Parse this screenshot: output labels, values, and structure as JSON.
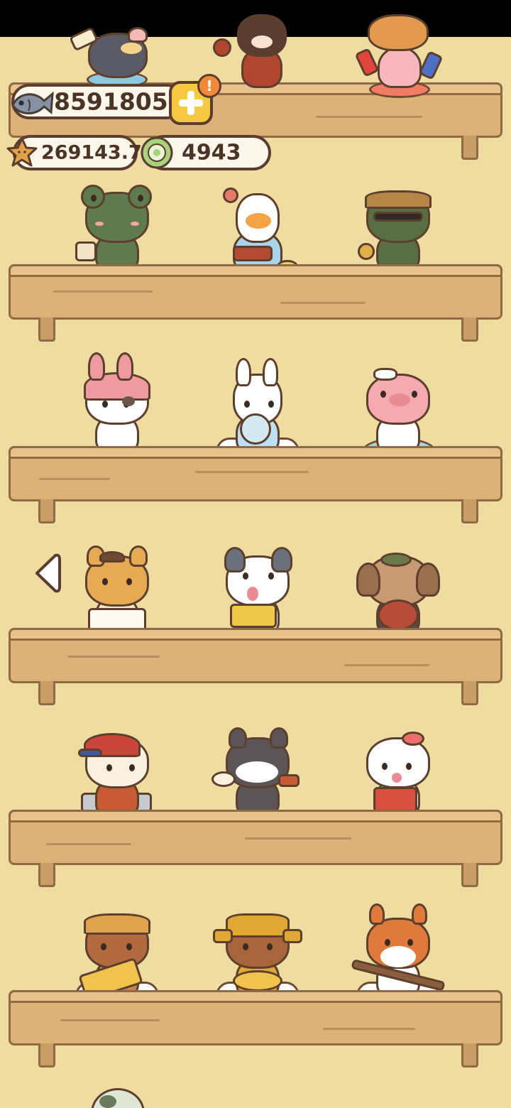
{
  "hud": {
    "fish_currency": "85918051",
    "star_currency": "269143.7",
    "coin_currency": "4943",
    "alert_badge": "!"
  },
  "icons": {
    "fish": "fish-icon",
    "star": "star-icon",
    "coin": "coin-icon",
    "plus": "plus-icon",
    "back": "chevron-left-icon"
  },
  "colors": {
    "background": "#efdca1",
    "shelf": "#dcb278",
    "outline": "#5a3d2e",
    "accent_button": "#f6c940",
    "alert": "#f08a3a"
  },
  "figurines": [
    [
      "penguin",
      "girl-doll",
      "corgi"
    ],
    [
      "frog",
      "duck-kimono",
      "frog-sunglasses"
    ],
    [
      "bunny-hood-pup",
      "white-bunny",
      "pig"
    ],
    [
      "shiba-reader",
      "aussie-dog-book",
      "poodle-heart"
    ],
    [
      "delivery-dog",
      "husky-suit",
      "white-cat-bag"
    ],
    [
      "otter-scroll",
      "bear-ingot",
      "squirrel-staff"
    ]
  ]
}
